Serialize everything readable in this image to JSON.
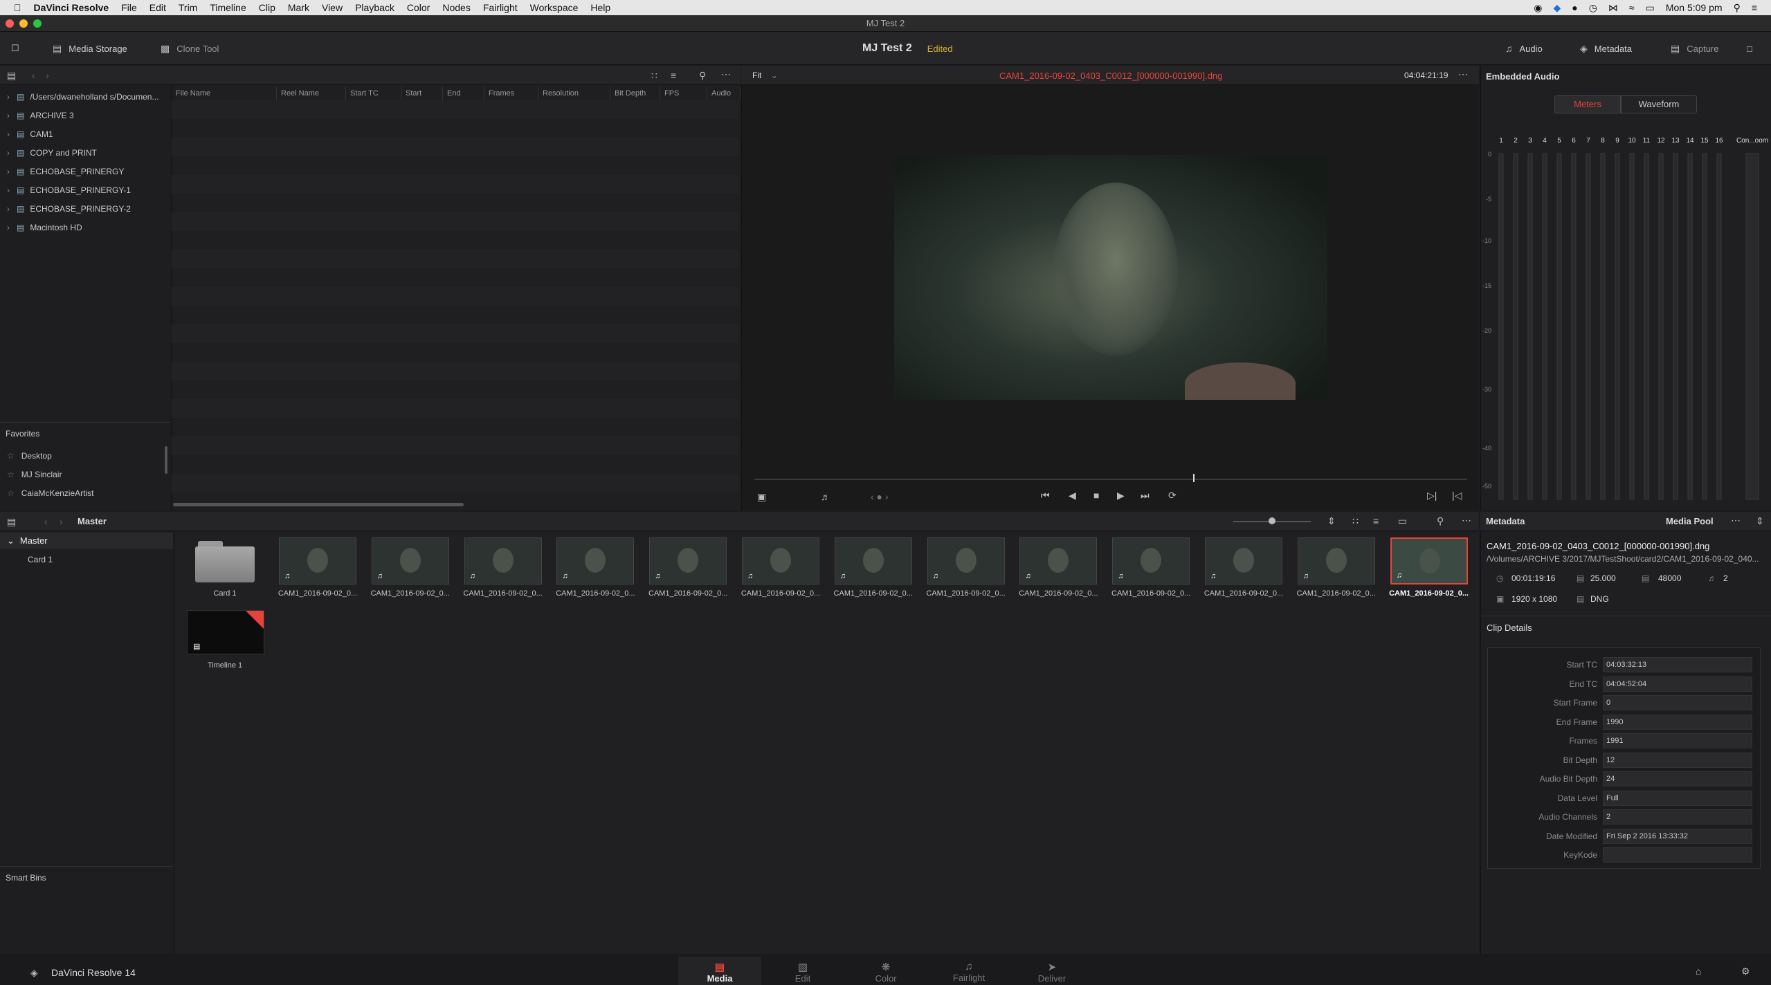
{
  "menubar": {
    "app": "DaVinci Resolve",
    "items": [
      "File",
      "Edit",
      "Trim",
      "Timeline",
      "Clip",
      "Mark",
      "View",
      "Playback",
      "Color",
      "Nodes",
      "Fairlight",
      "Workspace",
      "Help"
    ],
    "clock": "Mon 5:09 pm"
  },
  "window": {
    "title": "MJ Test 2"
  },
  "toolbar": {
    "media_storage": "Media Storage",
    "clone_tool": "Clone Tool",
    "project_name": "MJ Test 2",
    "project_status": "Edited",
    "audio": "Audio",
    "metadata": "Metadata",
    "capture": "Capture"
  },
  "storage": {
    "items": [
      "/Users/dwaneholland s/Documen...",
      "ARCHIVE 3",
      "CAM1",
      "COPY and PRINT",
      "ECHOBASE_PRINERGY",
      "ECHOBASE_PRINERGY-1",
      "ECHOBASE_PRINERGY-2",
      "Macintosh HD"
    ]
  },
  "favorites": {
    "title": "Favorites",
    "items": [
      "Desktop",
      "MJ Sinclair",
      "CaiaMcKenzieArtist"
    ]
  },
  "file_table": {
    "columns": [
      "File Name",
      "Reel Name",
      "Start TC",
      "Start",
      "End",
      "Frames",
      "Resolution",
      "Bit Depth",
      "FPS",
      "Audio Ch"
    ]
  },
  "viewer": {
    "zoom": "Fit",
    "clip_name": "CAM1_2016-09-02_0403_C0012_[000000-001990].dng",
    "timecode": "04:04:21:19"
  },
  "audio_panel": {
    "title": "Embedded Audio",
    "tab_meters": "Meters",
    "tab_waveform": "Waveform",
    "channels": [
      "1",
      "2",
      "3",
      "4",
      "5",
      "6",
      "7",
      "8",
      "9",
      "10",
      "11",
      "12",
      "13",
      "14",
      "15",
      "16"
    ],
    "control_room": "Con...oom",
    "db_scale": [
      "0",
      "-5",
      "-10",
      "-15",
      "-20",
      "-30",
      "-40",
      "-50"
    ]
  },
  "bins": {
    "header": "Master",
    "master": "Master",
    "card": "Card 1",
    "smart_bins": "Smart Bins"
  },
  "pool": {
    "folder_label": "Card 1",
    "clip_label": "CAM1_2016-09-02_0...",
    "clip_count": 13,
    "timeline_label": "Timeline 1"
  },
  "metadata": {
    "title": "Metadata",
    "pool_title": "Media Pool",
    "clip_name": "CAM1_2016-09-02_0403_C0012_[000000-001990].dng",
    "path": "/Volumes/ARCHIVE 3/2017/MJTestShoot/card2/CAM1_2016-09-02_040...",
    "duration": "00:01:19:16",
    "fps": "25.000",
    "sample_rate": "48000",
    "channels": "2",
    "resolution": "1920 x 1080",
    "codec": "DNG",
    "clip_details_title": "Clip Details",
    "fields": [
      {
        "label": "Start TC",
        "value": "04:03:32:13"
      },
      {
        "label": "End TC",
        "value": "04:04:52:04"
      },
      {
        "label": "Start Frame",
        "value": "0"
      },
      {
        "label": "End Frame",
        "value": "1990"
      },
      {
        "label": "Frames",
        "value": "1991"
      },
      {
        "label": "Bit Depth",
        "value": "12"
      },
      {
        "label": "Audio Bit Depth",
        "value": "24"
      },
      {
        "label": "Data Level",
        "value": "Full"
      },
      {
        "label": "Audio Channels",
        "value": "2"
      },
      {
        "label": "Date Modified",
        "value": "Fri Sep 2 2016 13:33:32"
      },
      {
        "label": "KeyKode",
        "value": ""
      }
    ]
  },
  "footer": {
    "brand": "DaVinci Resolve 14",
    "pages": [
      "Media",
      "Edit",
      "Color",
      "Fairlight",
      "Deliver"
    ]
  },
  "colors": {
    "accent_red": "#e8433b",
    "accent_yellow": "#d5b33a",
    "bg": "#1c1c1e"
  }
}
